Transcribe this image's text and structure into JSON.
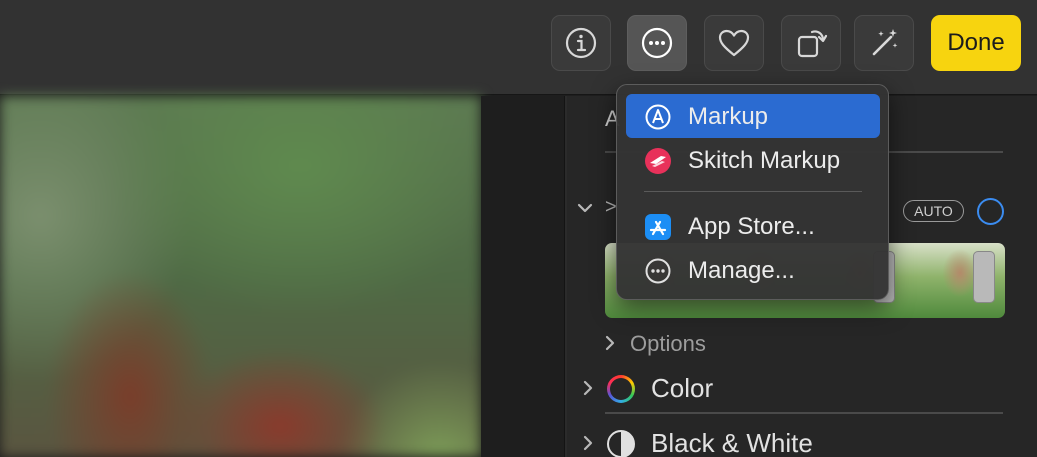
{
  "toolbar": {
    "buttons": [
      {
        "icon": "info-icon"
      },
      {
        "icon": "more-icon"
      },
      {
        "icon": "heart-icon"
      },
      {
        "icon": "rotate-icon"
      },
      {
        "icon": "magic-wand-icon"
      }
    ],
    "done_label": "Done",
    "accent_color": "#f7d40f"
  },
  "panel": {
    "section_heading": "A",
    "collapsed_marker": ">",
    "auto_label": "AUTO",
    "options_label": "Options",
    "color_label": "Color",
    "black_white_label": "Black & White"
  },
  "menu": {
    "items": [
      {
        "label": "Markup",
        "icon": "markup-icon",
        "highlighted": true
      },
      {
        "label": "Skitch Markup",
        "icon": "skitch-icon",
        "highlighted": false
      },
      {
        "label": "App Store...",
        "icon": "app-store-icon",
        "highlighted": false
      },
      {
        "label": "Manage...",
        "icon": "more-icon",
        "highlighted": false
      }
    ],
    "highlight_color": "#2b6bd1"
  }
}
